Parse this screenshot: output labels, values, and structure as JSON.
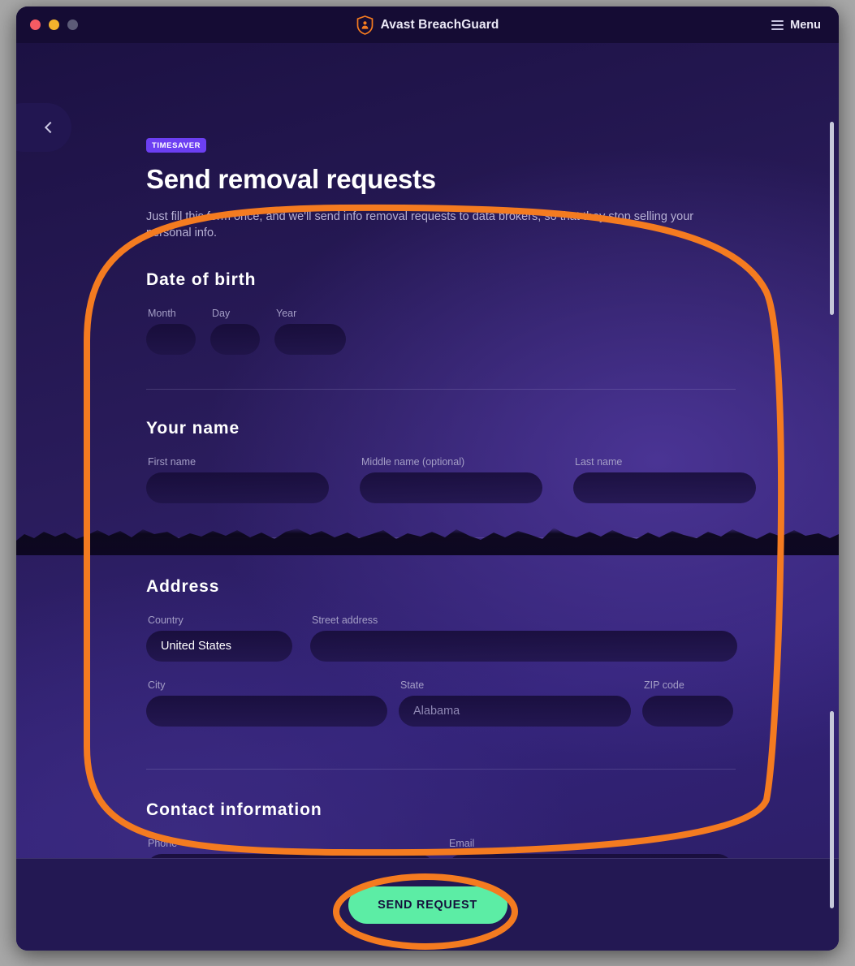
{
  "window": {
    "traffic_lights": [
      {
        "name": "close",
        "color": "#f45b63"
      },
      {
        "name": "minimize",
        "color": "#f2b32c"
      },
      {
        "name": "maximize",
        "color": "#5c5b77"
      }
    ],
    "app_title": "Avast BreachGuard",
    "menu_label": "Menu",
    "back_icon": "chevron-left-icon",
    "logo_icon": "shield-person-icon"
  },
  "header": {
    "badge": "TIMESAVER",
    "title": "Send removal requests",
    "subtitle": "Just fill this form once, and we'll send info removal requests to data brokers, so that they stop selling your personal info."
  },
  "sections": [
    {
      "id": "date-of-birth",
      "title": "Date of birth",
      "fields": [
        {
          "name": "month",
          "label": "Month",
          "value": "",
          "placeholder": ""
        },
        {
          "name": "day",
          "label": "Day",
          "value": "",
          "placeholder": ""
        },
        {
          "name": "year",
          "label": "Year",
          "value": "",
          "placeholder": ""
        }
      ]
    },
    {
      "id": "your-name",
      "title": "Your name",
      "fields": [
        {
          "name": "first-name",
          "label": "First name",
          "value": "",
          "placeholder": ""
        },
        {
          "name": "middle-name",
          "label": "Middle name (optional)",
          "value": "",
          "placeholder": ""
        },
        {
          "name": "last-name",
          "label": "Last name",
          "value": "",
          "placeholder": ""
        }
      ]
    },
    {
      "id": "address",
      "title": "Address",
      "fields": [
        {
          "name": "country",
          "label": "Country",
          "value": "United States",
          "placeholder": ""
        },
        {
          "name": "street-address",
          "label": "Street address",
          "value": "",
          "placeholder": ""
        },
        {
          "name": "city",
          "label": "City",
          "value": "",
          "placeholder": ""
        },
        {
          "name": "state",
          "label": "State",
          "value": "",
          "placeholder": "Alabama"
        },
        {
          "name": "zip-code",
          "label": "ZIP code",
          "value": "",
          "placeholder": ""
        }
      ]
    },
    {
      "id": "contact-information",
      "title": "Contact information",
      "fields": [
        {
          "name": "phone",
          "label": "Phone",
          "value": "",
          "placeholder": ""
        },
        {
          "name": "email",
          "label": "Email",
          "value": "",
          "placeholder": ""
        }
      ]
    }
  ],
  "labels": {
    "date_of_birth": "Date of birth",
    "month": "Month",
    "day": "Day",
    "year": "Year",
    "your_name": "Your name",
    "first_name": "First name",
    "middle_name": "Middle name (optional)",
    "last_name": "Last name",
    "address": "Address",
    "country": "Country",
    "country_value": "United States",
    "street_address": "Street address",
    "city": "City",
    "state": "State",
    "state_placeholder": "Alabama",
    "zip_code": "ZIP code",
    "contact_information": "Contact information",
    "phone": "Phone",
    "email": "Email"
  },
  "footer": {
    "submit_label": "SEND REQUEST"
  },
  "colors": {
    "accent_orange": "#F47B20",
    "brand_orange": "#FF7800",
    "badge_purple": "#6C3FF2",
    "submit_green": "#5CEDA5",
    "window_dark": "#150C34",
    "bg_deep": "#1C1143",
    "bg_mid": "#33237A",
    "text_muted": "#A49EC6",
    "scrollbar": "#C6C8DA"
  },
  "annotations": [
    {
      "name": "form-highlight-ellipse",
      "shape": "rounded-outline",
      "color": "#F47B20"
    },
    {
      "name": "send-request-highlight-ellipse",
      "shape": "ellipse-outline",
      "color": "#F47B20"
    }
  ]
}
